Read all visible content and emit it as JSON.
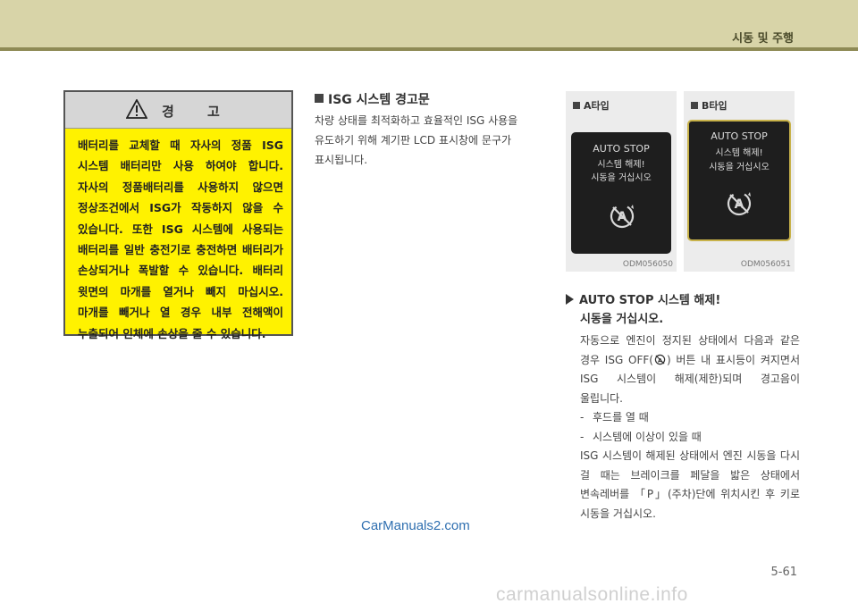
{
  "header": {
    "title": "시동 및 주행"
  },
  "warning": {
    "title": "경 고",
    "text": "배터리를 교체할 때 자사의 정품 ISG 시스템 배터리만 사용 하여야 합니다. 자사의 정품배터리를 사용하지 않으면 정상조건에서 ISG가 작동하지 않을 수 있습니다. 또한 ISG 시스템에 사용되는 배터리를 일반 충전기로 충전하면 배터리가 손상되거나 폭발할 수 있습니다. 배터리 윗면의 마개를 열거나 빼지 마십시오. 마개를 빼거나 열 경우 내부 전해액이 누출되어 인체에 손상을 줄 수 있습니다."
  },
  "isg_section": {
    "title": "ISG 시스템 경고문",
    "body": "차량 상태를 최적화하고 효율적인 ISG 사용을 유도하기 위해 계기판 LCD 표시창에 문구가 표시됩니다."
  },
  "panels": [
    {
      "label": "A타입",
      "line1": "AUTO STOP",
      "line2": "시스템 해제!",
      "line3": "시동을 거십시오",
      "code": "ODM056050",
      "icon": "isg-off-icon"
    },
    {
      "label": "B타입",
      "line1": "AUTO STOP",
      "line2": "시스템 해제!",
      "line3": "시동을 거십시오",
      "code": "ODM056051",
      "icon": "isg-off-icon"
    }
  ],
  "auto_stop": {
    "title": "AUTO STOP 시스템 해제!",
    "subtitle": "시동을 거십시오.",
    "para1_a": "자동으로 엔진이 정지된 상태에서 다음과 같은 경우 ISG OFF(",
    "para1_b": ") 버튼 내 표시등이 켜지면서 ISG 시스템이 해제(제한)되며 경고음이 울립니다.",
    "bullets": [
      "후드를 열 때",
      "시스템에 이상이 있을 때"
    ],
    "para2": "ISG 시스템이 해제된 상태에서 엔진 시동을 다시 걸 때는 브레이크를 페달을 밟은 상태에서 변속레버를 「P」(주차)단에 위치시킨 후 키로 시동을 거십시오."
  },
  "watermark_top": "CarManuals2.com",
  "page_number": "5-61",
  "watermark_bottom": "carmanualsonline.info",
  "colors": {
    "warning_bg": "#fff200",
    "header_bg": "#d8d4a8",
    "header_line": "#8e8a55",
    "screen_bg": "#1e1e1e"
  }
}
